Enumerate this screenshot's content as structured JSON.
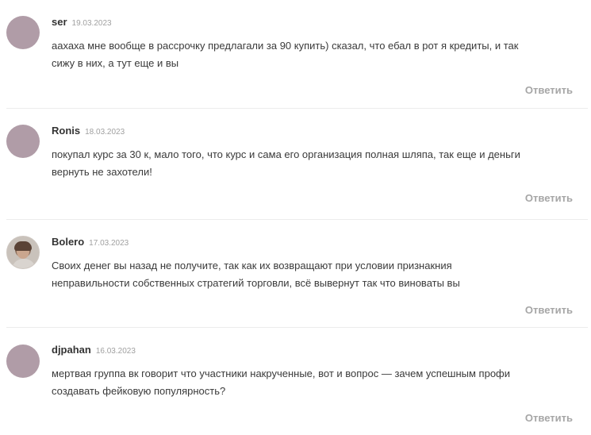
{
  "comments": [
    {
      "author": "ser",
      "date": "19.03.2023",
      "text": "аахаха мне вообще в рассрочку предлагали за 90 купить) сказал, что ебал в рот я кредиты, и так сижу в них, а тут еще и вы",
      "reply_label": "Ответить",
      "avatar_color": "#b09ca7"
    },
    {
      "author": "Ronis",
      "date": "18.03.2023",
      "text": "покупал курс за 30 к, мало того, что курс и сама его организация полная шляпа, так еще и деньги вернуть не захотели!",
      "reply_label": "Ответить",
      "avatar_color": "#b09ca7"
    },
    {
      "author": "Bolero",
      "date": "17.03.2023",
      "text": "Своих денег вы назад не получите, так как их возвращают при условии признакния неправильности собственных стратегий торговли, всё вывернут так что виноваты вы",
      "reply_label": "Ответить",
      "avatar_icon": "user-photo-icon"
    },
    {
      "author": "djpahan",
      "date": "16.03.2023",
      "text": "мертвая группа вк говорит что участники накрученные, вот и вопрос — зачем успешным профи создавать фейковую популярность?",
      "reply_label": "Ответить",
      "avatar_color": "#b09ca7"
    }
  ]
}
